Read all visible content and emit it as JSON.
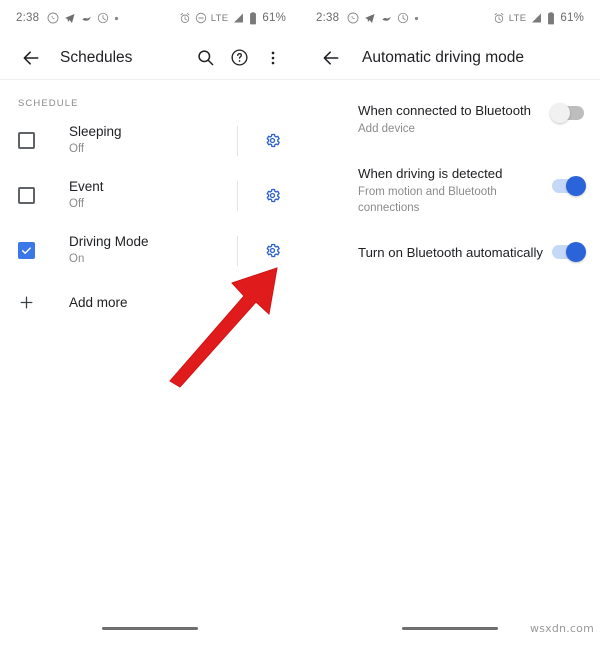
{
  "left": {
    "status_bar": {
      "time": "2:38",
      "left_icons": [
        "whatsapp-icon",
        "telegram-icon",
        "bird-icon",
        "clock-outline-icon",
        "dot-icon"
      ],
      "right_icons": [
        "alarm-icon",
        "do-not-disturb-icon",
        "signal-icon",
        "battery-icon"
      ],
      "network": "LTE",
      "battery": "61%"
    },
    "toolbar": {
      "back_icon": "back-arrow-icon",
      "title": "Schedules",
      "search_icon": "search-icon",
      "help_icon": "help-circle-icon",
      "overflow_icon": "more-vertical-icon"
    },
    "section_label": "SCHEDULE",
    "items": [
      {
        "title": "Sleeping",
        "subtitle": "Off",
        "checked": false,
        "gear_icon": "gear-icon"
      },
      {
        "title": "Event",
        "subtitle": "Off",
        "checked": false,
        "gear_icon": "gear-icon"
      },
      {
        "title": "Driving Mode",
        "subtitle": "On",
        "checked": true,
        "gear_icon": "gear-icon"
      }
    ],
    "add_more": {
      "label": "Add more",
      "icon": "plus-icon"
    }
  },
  "right": {
    "status_bar": {
      "time": "2:38",
      "left_icons": [
        "whatsapp-icon",
        "telegram-icon",
        "bird-icon",
        "clock-outline-icon",
        "dot-icon"
      ],
      "right_icons": [
        "alarm-icon",
        "signal-icon",
        "battery-icon"
      ],
      "network": "LTE",
      "battery": "61%"
    },
    "toolbar": {
      "back_icon": "back-arrow-icon",
      "title": "Automatic driving mode"
    },
    "settings": [
      {
        "title": "When connected to Bluetooth",
        "subtitle": "Add device",
        "state": "off"
      },
      {
        "title": "When driving is detected",
        "subtitle": "From motion and Bluetooth connections",
        "state": "on"
      },
      {
        "title": "Turn on Bluetooth automatically",
        "subtitle": "",
        "state": "on"
      }
    ]
  },
  "annotation": {
    "arrow_color": "#e01b1b",
    "arrow_target": "gear-icon-driving-mode"
  },
  "watermark": "wsxdn.com",
  "colors": {
    "accent_blue": "#3b78e7",
    "gear_blue": "#2d62cc",
    "toggle_on": "#2b63d9",
    "text_primary": "#202124",
    "text_secondary": "#8b8b8b"
  }
}
